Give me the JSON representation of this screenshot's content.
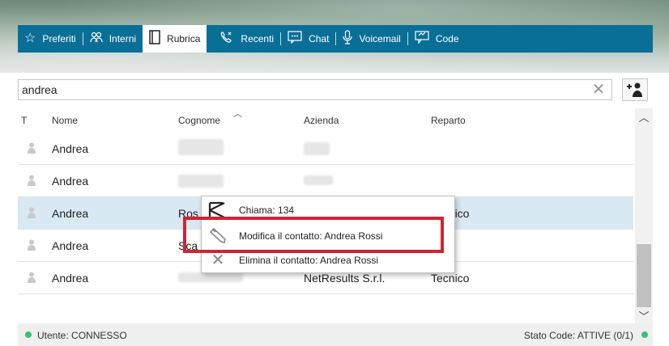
{
  "tabs": [
    {
      "label": "Preferiti",
      "icon": "star-icon",
      "active": false
    },
    {
      "label": "Interni",
      "icon": "users-icon",
      "active": false
    },
    {
      "label": "Rubrica",
      "icon": "book-icon",
      "active": true
    },
    {
      "label": "Recenti",
      "icon": "phone-history-icon",
      "active": false
    },
    {
      "label": "Chat",
      "icon": "chat-icon",
      "active": false
    },
    {
      "label": "Voicemail",
      "icon": "microphone-icon",
      "active": false
    },
    {
      "label": "Code",
      "icon": "queue-icon",
      "active": false
    }
  ],
  "search": {
    "value": "andrea",
    "clear_icon": "close-icon",
    "add_icon": "add-contact-icon"
  },
  "table": {
    "headers": {
      "type": "T",
      "nome": "Nome",
      "cognome": "Cognome",
      "azienda": "Azienda",
      "reparto": "Reparto"
    },
    "rows": [
      {
        "nome": "Andrea",
        "cognome": "",
        "azienda": "",
        "reparto": "",
        "selected": false
      },
      {
        "nome": "Andrea",
        "cognome": "",
        "azienda": "",
        "reparto": "",
        "selected": false
      },
      {
        "nome": "Andrea",
        "cognome": "Ros",
        "azienda": "",
        "reparto": "Tecnico",
        "selected": true
      },
      {
        "nome": "Andrea",
        "cognome": "Sca",
        "azienda": "",
        "reparto": "",
        "selected": false
      },
      {
        "nome": "Andrea",
        "cognome": "",
        "azienda": "NetResults S.r.l.",
        "reparto": "Tecnico",
        "selected": false
      }
    ]
  },
  "context_menu": {
    "call": "Chiama: 134",
    "edit": "Modifica il contatto: Andrea Rossi",
    "delete": "Elimina il contatto: Andrea Rossi"
  },
  "status": {
    "user": "Utente: CONNESSO",
    "queue": "Stato Code: ATTIVE (0/1)",
    "status_color": "#35c46b"
  },
  "colors": {
    "tabbar": "#0a6f97",
    "selected_row": "#d8e9f3",
    "highlight": "#d12433"
  }
}
